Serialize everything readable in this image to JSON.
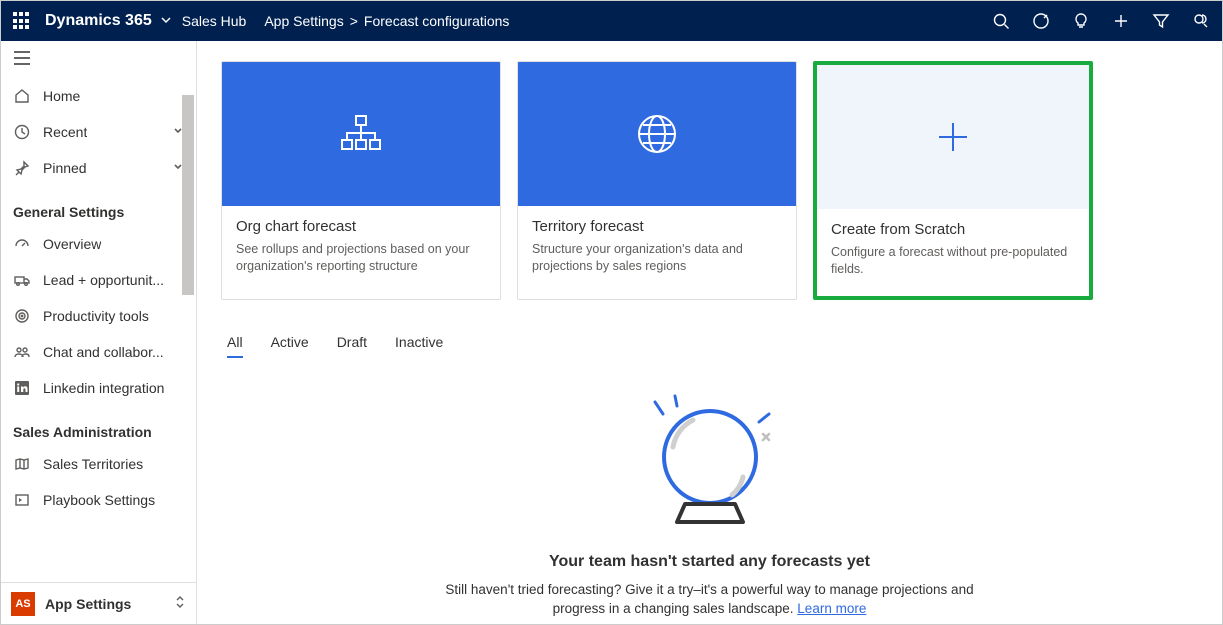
{
  "brand": "Dynamics 365",
  "app": "Sales Hub",
  "breadcrumb": {
    "lvl1": "App Settings",
    "lvl2": "Forecast configurations"
  },
  "sidebar": {
    "home": "Home",
    "recent": "Recent",
    "pinned": "Pinned",
    "sections": [
      {
        "label": "General Settings",
        "items": [
          {
            "text": "Overview"
          },
          {
            "text": "Lead + opportunit..."
          },
          {
            "text": "Productivity tools"
          },
          {
            "text": "Chat and collabor..."
          },
          {
            "text": "Linkedin integration"
          }
        ]
      },
      {
        "label": "Sales Administration",
        "items": [
          {
            "text": "Sales Territories"
          },
          {
            "text": "Playbook Settings"
          }
        ]
      }
    ],
    "area_badge": "AS",
    "area_name": "App Settings"
  },
  "cards": [
    {
      "title": "Org chart forecast",
      "desc": "See rollups and projections based on your organization's reporting structure",
      "style": "blue",
      "icon": "org-chart",
      "highlight": false
    },
    {
      "title": "Territory forecast",
      "desc": "Structure your organization's data and projections by sales regions",
      "style": "blue",
      "icon": "globe",
      "highlight": false
    },
    {
      "title": "Create from Scratch",
      "desc": "Configure a forecast without pre-populated fields.",
      "style": "light",
      "icon": "plus",
      "highlight": true
    }
  ],
  "tabs": [
    "All",
    "Active",
    "Draft",
    "Inactive"
  ],
  "active_tab": "All",
  "empty": {
    "title": "Your team hasn't started any forecasts yet",
    "sub": "Still haven't tried forecasting? Give it a try–it's a powerful way to manage projections and progress in a changing sales landscape. ",
    "link": "Learn more"
  }
}
